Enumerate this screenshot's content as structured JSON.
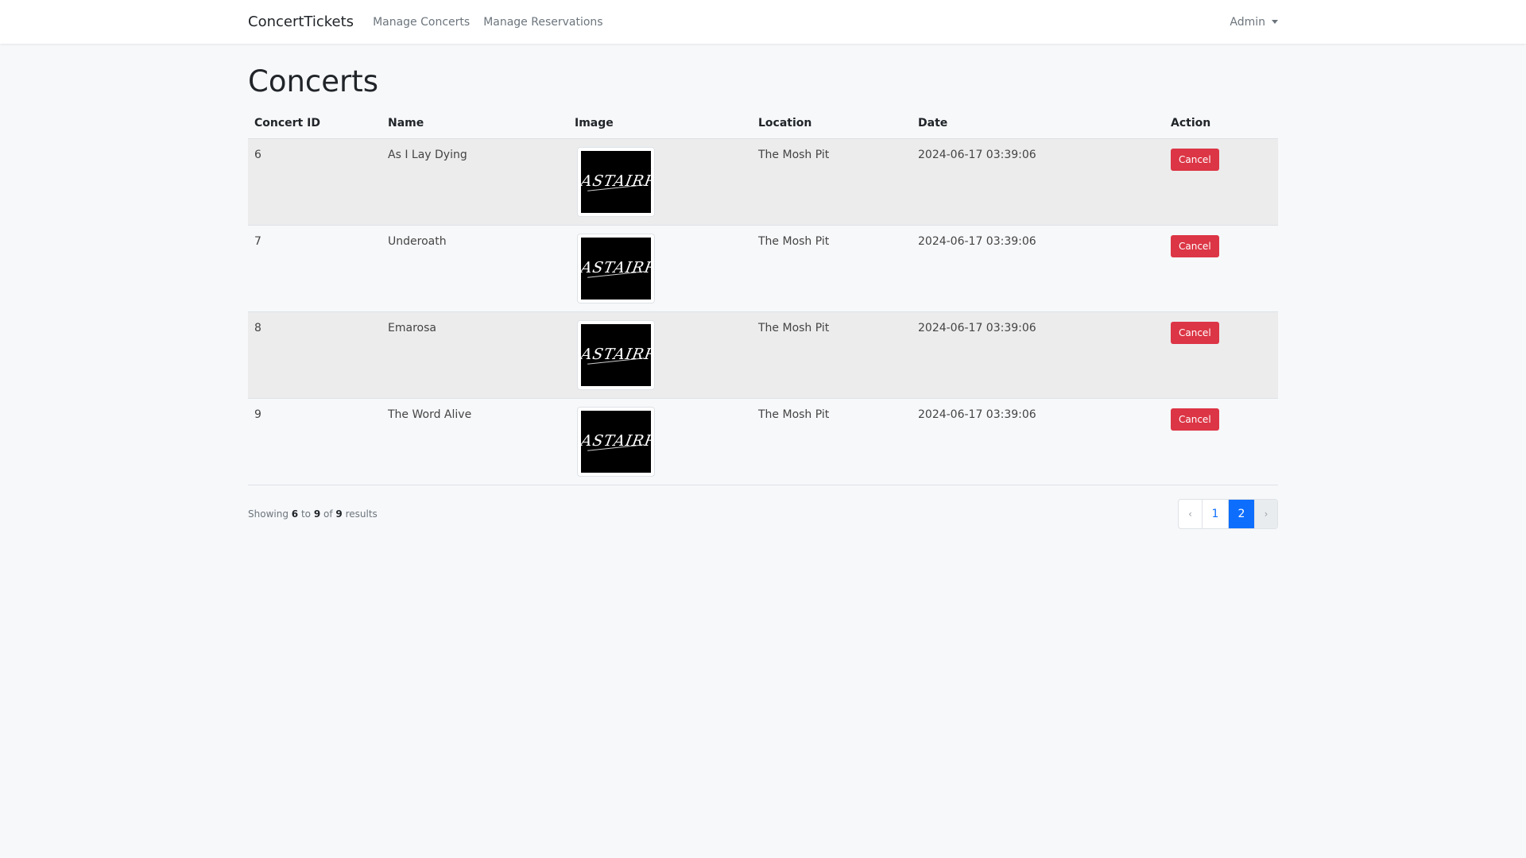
{
  "nav": {
    "brand": "ConcertTickets",
    "links": [
      "Manage Concerts",
      "Manage Reservations"
    ],
    "user_menu": "Admin"
  },
  "page": {
    "title": "Concerts"
  },
  "table": {
    "headers": [
      "Concert ID",
      "Name",
      "Image",
      "Location",
      "Date",
      "Action"
    ],
    "rows": [
      {
        "id": "6",
        "name": "As I Lay Dying",
        "image_text": "ASTAIRRE",
        "location": "The Mosh Pit",
        "date": "2024-06-17 03:39:06",
        "action": "Cancel"
      },
      {
        "id": "7",
        "name": "Underoath",
        "image_text": "ASTAIRRE",
        "location": "The Mosh Pit",
        "date": "2024-06-17 03:39:06",
        "action": "Cancel"
      },
      {
        "id": "8",
        "name": "Emarosa",
        "image_text": "ASTAIRRE",
        "location": "The Mosh Pit",
        "date": "2024-06-17 03:39:06",
        "action": "Cancel"
      },
      {
        "id": "9",
        "name": "The Word Alive",
        "image_text": "ASTAIRRE",
        "location": "The Mosh Pit",
        "date": "2024-06-17 03:39:06",
        "action": "Cancel"
      }
    ]
  },
  "pagination": {
    "showing_prefix": "Showing",
    "from": "6",
    "to_word": "to",
    "to": "9",
    "of_word": "of",
    "total": "9",
    "suffix": "results",
    "prev": "‹",
    "pages": [
      "1",
      "2"
    ],
    "next": "›",
    "active_page": "2"
  },
  "colors": {
    "danger": "#dc3545",
    "primary": "#0d6efd",
    "background": "#f7f8fa"
  }
}
